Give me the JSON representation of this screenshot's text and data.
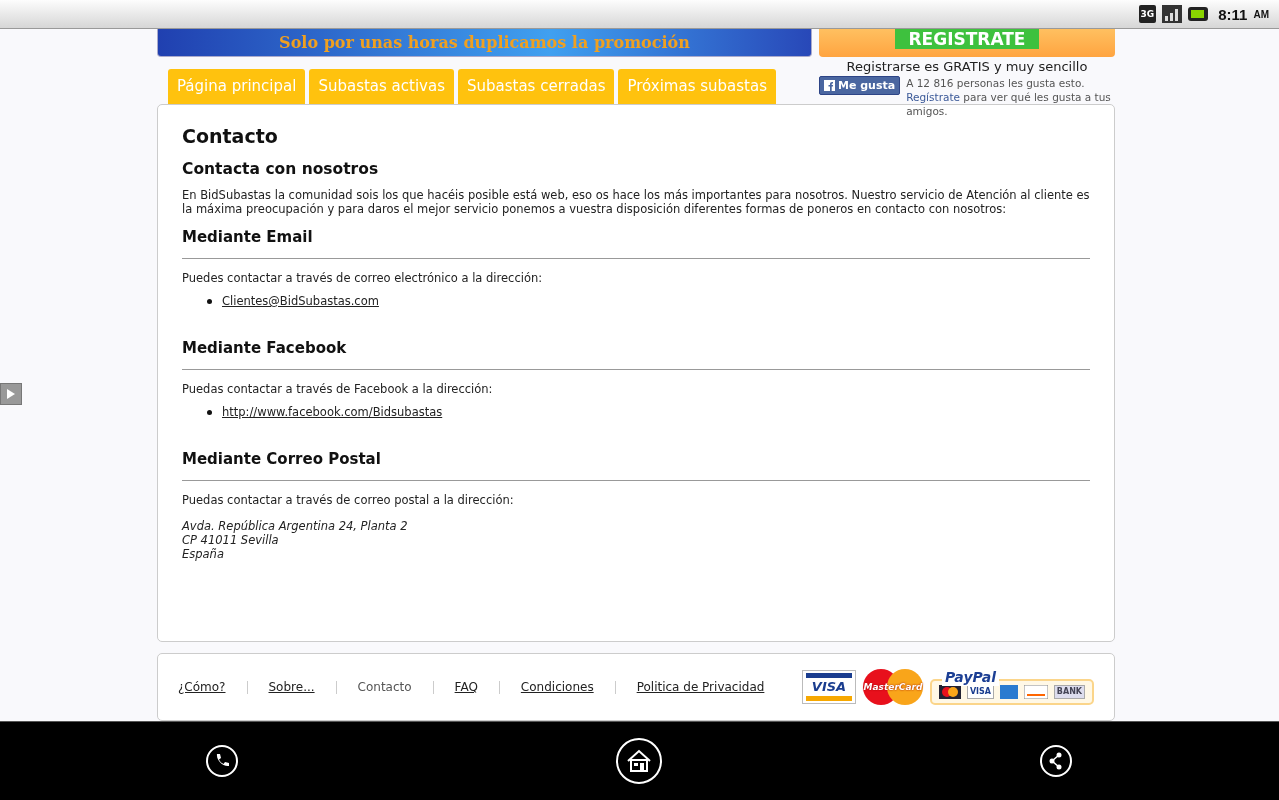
{
  "status_bar": {
    "network": "3G",
    "time": "8:11",
    "meridiem": "AM"
  },
  "banner": {
    "text": "Solo por unas horas duplicamos la promoción"
  },
  "register": {
    "button": "REGISTRATE",
    "note": "Registrarse es GRATIS y muy sencillo"
  },
  "like_box": {
    "button": "Me gusta",
    "count_text": "A 12 816 personas les gusta esto.",
    "link": "Regístrate",
    "after_link": "para ver qué les gusta a tus amigos."
  },
  "tabs": [
    {
      "label": "Página principal",
      "selected": false
    },
    {
      "label": "Subastas activas",
      "selected": false
    },
    {
      "label": "Subastas cerradas",
      "selected": false
    },
    {
      "label": "Próximas subastas",
      "selected": false
    }
  ],
  "content": {
    "title": "Contacto",
    "subtitle": "Contacta con nosotros",
    "intro": "En BidSubastas la comunidad sois los que hacéis posible está web, eso os hace los más importantes para nosotros. Nuestro servicio de Atención al cliente es la máxima preocupación y para daros el mejor servicio ponemos a vuestra disposición diferentes formas de poneros en contacto con nosotros:",
    "sections": [
      {
        "kind": "links",
        "heading": "Mediante Email",
        "text": "Puedes contactar a través de correo electrónico a la dirección:",
        "items": [
          "Clientes@BidSubastas.com"
        ]
      },
      {
        "kind": "links",
        "heading": "Mediante Facebook",
        "text": "Puedas contactar a través de Facebook a la dirección:",
        "items": [
          "http://www.facebook.com/Bidsubastas"
        ]
      },
      {
        "kind": "address",
        "heading": "Mediante Correo Postal",
        "text": "Puedas contactar a través de correo postal a la dirección:",
        "items": [
          "Avda. República Argentina 24, Planta 2",
          "CP 41011 Sevilla",
          "España"
        ]
      }
    ]
  },
  "footer": {
    "links": [
      {
        "label": "¿Cómo?",
        "selected": false
      },
      {
        "label": "Sobre...",
        "selected": false
      },
      {
        "label": "Contacto",
        "selected": true
      },
      {
        "label": "FAQ",
        "selected": false
      },
      {
        "label": "Condiciones",
        "selected": false
      },
      {
        "label": "Politica de Privacidad",
        "selected": false
      }
    ],
    "payments": {
      "visa": "VISA",
      "mastercard": "MasterCard",
      "paypal": "PayPal",
      "paypal_visa": "VISA",
      "bank": "BANK"
    }
  }
}
